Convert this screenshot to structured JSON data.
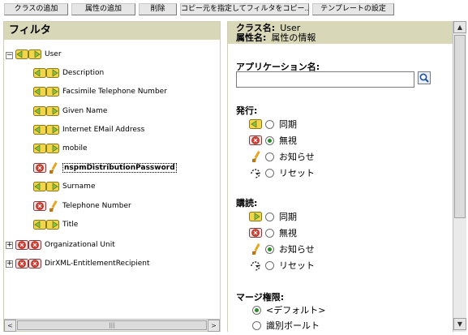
{
  "toolbar": {
    "add_class": "クラスの追加",
    "add_attribute": "属性の追加",
    "delete": "削除",
    "copy_filter": "コピー元を指定してフィルタをコピー...",
    "template_settings": "テンプレートの設定"
  },
  "filter_panel": {
    "title": "フィルタ",
    "nodes": [
      {
        "label": "User",
        "expander": "−"
      },
      {
        "label": "Description"
      },
      {
        "label": "Facsimile Telephone Number"
      },
      {
        "label": "Given Name"
      },
      {
        "label": "Internet EMail Address"
      },
      {
        "label": "mobile"
      },
      {
        "label": "nspmDistributionPassword"
      },
      {
        "label": "Surname"
      },
      {
        "label": "Telephone Number"
      },
      {
        "label": "Title"
      },
      {
        "label": "Organizational Unit",
        "expander": "+"
      },
      {
        "label": "DirXML-EntitlementRecipient",
        "expander": "+"
      }
    ],
    "scroll_thumb_glyph": "|||"
  },
  "details": {
    "class_name_label": "クラス名:",
    "class_name_value": "User",
    "attr_name_label": "属性名:",
    "attr_name_value": "属性の情報",
    "app_name_label": "アプリケーション名:",
    "app_name_value": "",
    "publish": {
      "title": "発行:",
      "options": [
        "同期",
        "無視",
        "お知らせ",
        "リセット"
      ],
      "selected": "無視"
    },
    "subscribe": {
      "title": "購読:",
      "options": [
        "同期",
        "無視",
        "お知らせ",
        "リセット"
      ],
      "selected": "お知らせ"
    },
    "merge": {
      "title": "マージ権限:",
      "options": [
        "<デフォルト>",
        "識別ボールト"
      ],
      "selected": "<デフォルト>"
    }
  },
  "scroll": {
    "left_arrow": "<",
    "right_arrow": ">",
    "up_arrow": "▲",
    "down_arrow": "▼"
  },
  "colors": {
    "panel_header": "#d8d8b8",
    "icon_green": "#8fbf3f",
    "icon_yellow": "#f1d54a",
    "icon_red": "#d83a2e",
    "radio_selected": "#2c8a2c"
  }
}
